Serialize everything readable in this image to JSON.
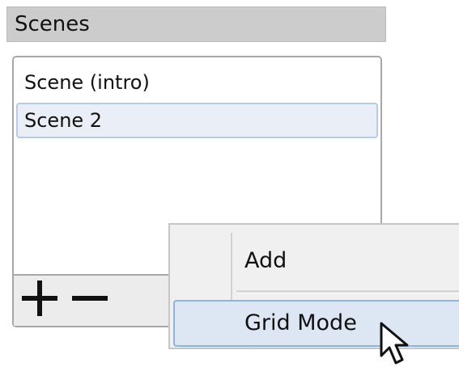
{
  "dock": {
    "title": "Scenes"
  },
  "scenes": {
    "items": [
      {
        "label": "Scene (intro)",
        "selected": false
      },
      {
        "label": "Scene 2",
        "selected": true
      }
    ]
  },
  "toolbar": {
    "add_icon": "plus-icon",
    "remove_icon": "minus-icon"
  },
  "context_menu": {
    "items": [
      {
        "label": "Add",
        "highlighted": false
      },
      {
        "label": "Grid Mode",
        "highlighted": true
      }
    ]
  },
  "colors": {
    "header_bg": "#cccccc",
    "selection_bg": "#e9eef7",
    "selection_border": "#b6cbe9",
    "menu_highlight_bg": "#dde6f3",
    "menu_highlight_border": "#8eb3e3"
  }
}
